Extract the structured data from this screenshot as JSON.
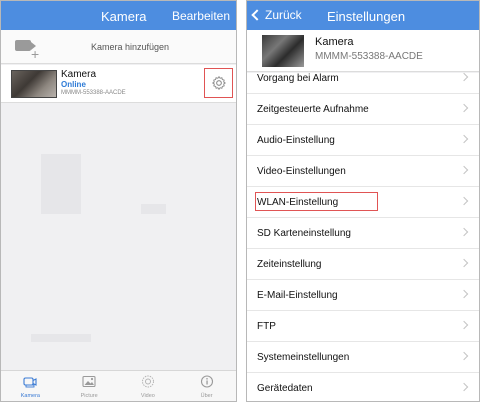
{
  "left": {
    "nav": {
      "title": "Kamera",
      "action": "Bearbeiten"
    },
    "add_label": "Kamera hinzufügen",
    "device": {
      "name": "Kamera",
      "status": "Online",
      "id": "MMMM-553388-AACDE"
    },
    "tabs": [
      {
        "label": "Kamera",
        "icon": "camera-tab-icon",
        "active": true
      },
      {
        "label": "Picture",
        "icon": "picture-tab-icon",
        "active": false
      },
      {
        "label": "Video",
        "icon": "video-tab-icon",
        "active": false
      },
      {
        "label": "Über",
        "icon": "info-tab-icon",
        "active": false
      }
    ]
  },
  "right": {
    "nav": {
      "back": "Zurück",
      "title": "Einstellungen"
    },
    "device": {
      "name": "Kamera",
      "id": "MMMM-553388-AACDE"
    },
    "menu": [
      "Vorgang bei Alarm",
      "Zeitgesteuerte Aufnahme",
      "Audio-Einstellung",
      "Video-Einstellungen",
      "WLAN-Einstellung",
      "SD Karteneinstellung",
      "Zeiteinstellung",
      "E-Mail-Einstellung",
      "FTP",
      "Systemeinstellungen",
      "Gerätedaten"
    ]
  },
  "colors": {
    "nav_blue": "#4d8de0",
    "status_blue": "#2e7bd6",
    "highlight_red": "#e05454"
  }
}
